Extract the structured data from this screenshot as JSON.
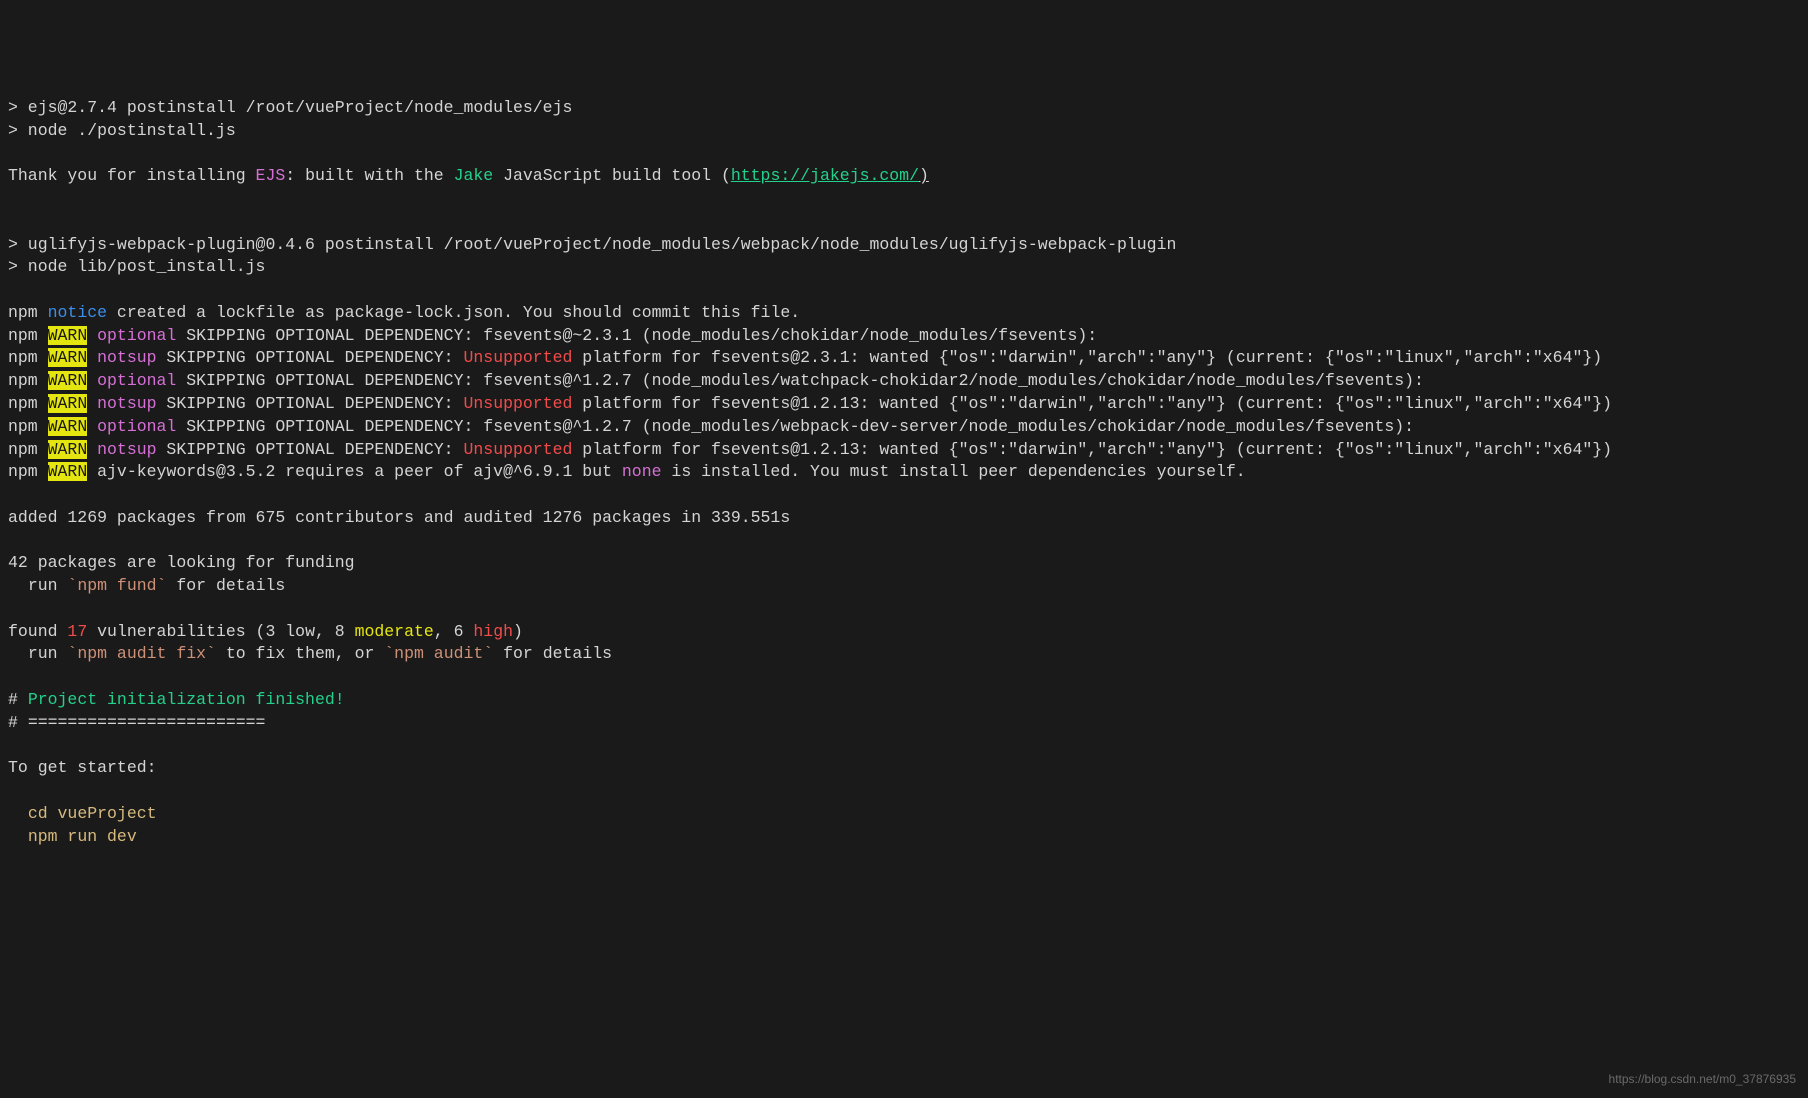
{
  "lines": {
    "l1a": "> ejs@2.7.4 postinstall /root/vueProject/node_modules/ejs",
    "l1b": "> node ./postinstall.js",
    "thank_pre": "Thank you for installing ",
    "thank_ejs": "EJS",
    "thank_mid1": ": built with the ",
    "thank_jake": "Jake",
    "thank_mid2": " JavaScript build tool (",
    "thank_url": "https://jakejs.com/",
    "thank_close": ")",
    "l3a": "> uglifyjs-webpack-plugin@0.4.6 postinstall /root/vueProject/node_modules/webpack/node_modules/uglifyjs-webpack-plugin",
    "l3b": "> node lib/post_install.js",
    "npm": "npm ",
    "warn": "WARN",
    "notice": "notice",
    "notice_msg": " created a lockfile as package-lock.json. You should commit this file.",
    "w1_tag": " optional",
    "w1_msg": " SKIPPING OPTIONAL DEPENDENCY: fsevents@~2.3.1 (node_modules/chokidar/node_modules/fsevents):",
    "w2_tag": " notsup",
    "w2_pre": " SKIPPING OPTIONAL DEPENDENCY: ",
    "w2_unsup": "Unsupported",
    "w2_post": " platform for fsevents@2.3.1: wanted {\"os\":\"darwin\",\"arch\":\"any\"} (current: {\"os\":\"linux\",\"arch\":\"x64\"})",
    "w3_tag": " optional",
    "w3_msg": " SKIPPING OPTIONAL DEPENDENCY: fsevents@^1.2.7 (node_modules/watchpack-chokidar2/node_modules/chokidar/node_modules/fsevents):",
    "w4_tag": " notsup",
    "w4_pre": " SKIPPING OPTIONAL DEPENDENCY: ",
    "w4_unsup": "Unsupported",
    "w4_post": " platform for fsevents@1.2.13: wanted {\"os\":\"darwin\",\"arch\":\"any\"} (current: {\"os\":\"linux\",\"arch\":\"x64\"})",
    "w5_tag": " optional",
    "w5_msg": " SKIPPING OPTIONAL DEPENDENCY: fsevents@^1.2.7 (node_modules/webpack-dev-server/node_modules/chokidar/node_modules/fsevents):",
    "w6_tag": " notsup",
    "w6_pre": " SKIPPING OPTIONAL DEPENDENCY: ",
    "w6_unsup": "Unsupported",
    "w6_post": " platform for fsevents@1.2.13: wanted {\"os\":\"darwin\",\"arch\":\"any\"} (current: {\"os\":\"linux\",\"arch\":\"x64\"})",
    "w7_pre": " ajv-keywords@3.5.2 requires a peer of ajv@^6.9.1 but ",
    "w7_none": "none",
    "w7_post": " is installed. You must install peer dependencies yourself.",
    "added": "added 1269 packages from 675 contributors and audited 1276 packages in 339.551s",
    "fund1": "42 packages are looking for funding",
    "fund2a": "  run ",
    "fund2b": "`npm fund`",
    "fund2c": " for details",
    "vuln_a": "found ",
    "vuln_17": "17",
    "vuln_b": " vulnerabilities (3 low, 8 ",
    "vuln_mod": "moderate",
    "vuln_c": ", 6 ",
    "vuln_high": "high",
    "vuln_d": ")",
    "audit_a": "  run ",
    "audit_fix": "`npm audit fix`",
    "audit_b": " to fix them, or ",
    "audit_cmd": "`npm audit`",
    "audit_c": " for details",
    "hash": "# ",
    "proj_init": "Project initialization finished!",
    "sep": "========================",
    "get_started": "To get started:",
    "cmd1": "  cd vueProject",
    "cmd2": "  npm run dev"
  },
  "watermark": "https://blog.csdn.net/m0_37876935"
}
